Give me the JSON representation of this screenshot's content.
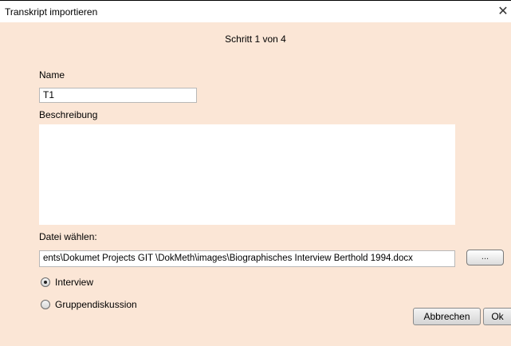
{
  "window": {
    "title": "Transkript importieren",
    "close_glyph": "✕"
  },
  "step": "Schritt 1 von 4",
  "form": {
    "name_label": "Name",
    "name_value": "T1",
    "description_label": "Beschreibung",
    "description_value": "",
    "file_label": "Datei wählen:",
    "file_value": "ents\\Dokumet  Projects  GIT  \\DokMeth\\images\\Biographisches Interview Berthold  1994.docx",
    "browse_label": "...",
    "type_options": [
      {
        "label": "Interview",
        "selected": true
      },
      {
        "label": "Gruppendiskussion",
        "selected": false
      }
    ]
  },
  "buttons": {
    "cancel": "Abbrechen",
    "ok": "Ok"
  },
  "colors": {
    "background": "#fbe6d6",
    "titlebar": "#ffffff"
  }
}
